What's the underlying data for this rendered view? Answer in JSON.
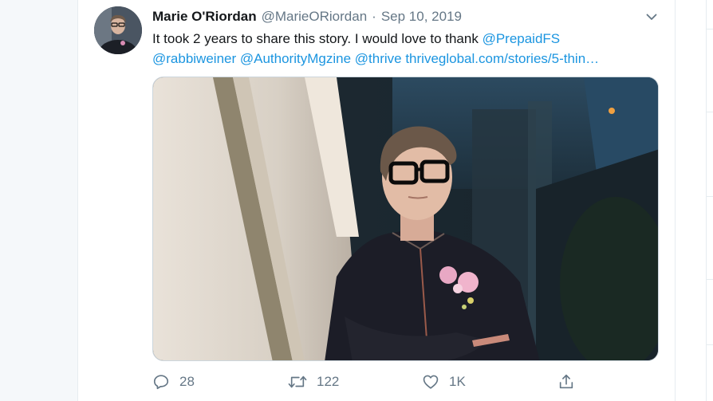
{
  "tweet": {
    "author": {
      "display_name": "Marie O'Riordan",
      "handle": "@MarieORiordan"
    },
    "separator": "·",
    "date": "Sep 10, 2019",
    "text": {
      "line1_prefix": "It took 2 years to share this story. I would love to thank ",
      "mention_prepaidfs": "@PrepaidFS",
      "mention_rabbiweiner": "@rabbiweiner",
      "mention_authoritymgzine": "@AuthorityMgzine",
      "mention_thrive": "@thrive",
      "url": "thriveglobal.com/stories/5-thin…"
    },
    "media": {
      "type": "photo"
    },
    "actions": {
      "replies": "28",
      "retweets": "122",
      "likes": "1K"
    }
  },
  "icons": {
    "caret": "chevron-down-icon",
    "reply": "reply-icon",
    "retweet": "retweet-icon",
    "like": "heart-icon",
    "share": "share-icon"
  },
  "colors": {
    "link": "#1b95e0",
    "secondary_text": "#657786",
    "primary_text": "#14171a",
    "border": "#e6ecf0"
  }
}
